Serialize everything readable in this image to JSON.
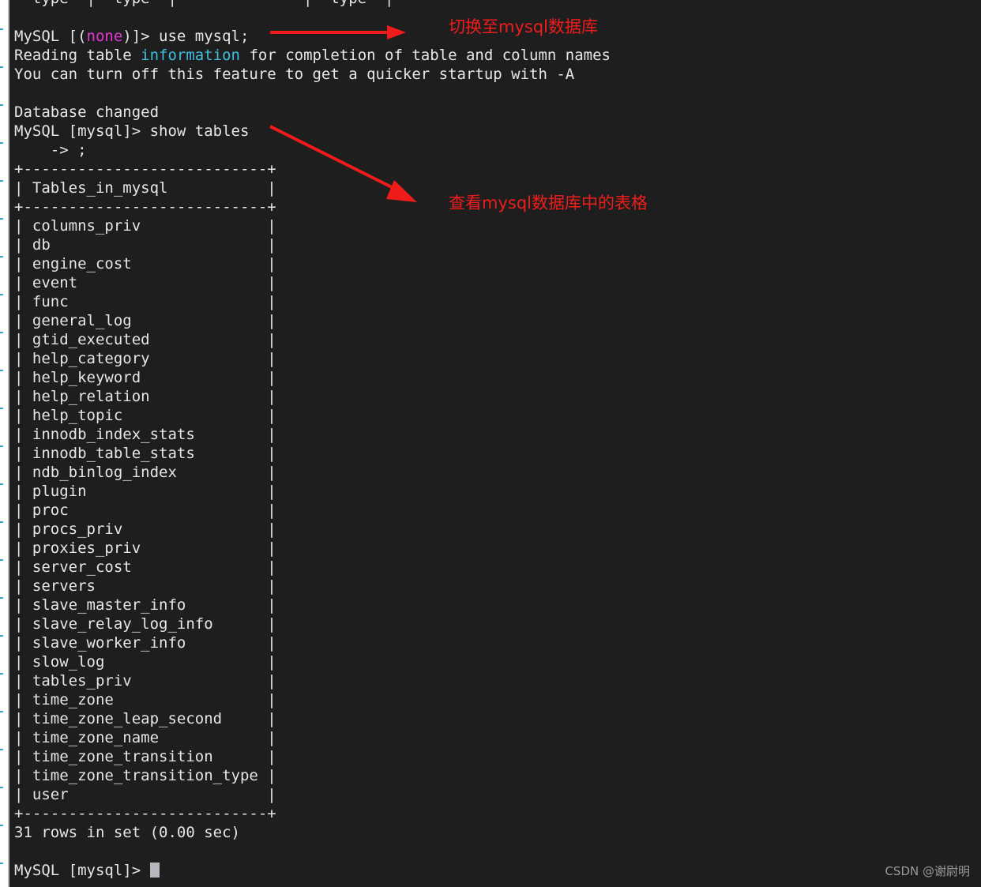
{
  "theme": {
    "terminal_bg": "#1e1e1e",
    "text_color": "#e6e6e6",
    "magenta": "#e23ad0",
    "cyan": "#3fbfe0",
    "annotation_red": "#f01c1c",
    "cursor_color": "#b6b6bd",
    "page_bg": "#ffffff"
  },
  "terminal": {
    "clipped_top_line": "  type  |  type  |              |  type  |",
    "prompt_1": {
      "prefix": "MySQL [(",
      "db": "none",
      "suffix": ")]> ",
      "command": "use mysql;"
    },
    "notice_1_pre": "Reading table ",
    "notice_1_kw": "information",
    "notice_1_post": " for completion of table and column names",
    "notice_2": "You can turn off this feature to get a quicker startup with -A",
    "blank_1": "",
    "db_changed": "Database changed",
    "prompt_2": {
      "prefix": "MySQL [mysql]> ",
      "command": "show tables"
    },
    "continuation": "    -> ;",
    "table": {
      "border": "+---------------------------+",
      "header": "| Tables_in_mysql           |",
      "rows": [
        "| columns_priv              |",
        "| db                        |",
        "| engine_cost               |",
        "| event                     |",
        "| func                      |",
        "| general_log               |",
        "| gtid_executed             |",
        "| help_category             |",
        "| help_keyword              |",
        "| help_relation             |",
        "| help_topic                |",
        "| innodb_index_stats        |",
        "| innodb_table_stats        |",
        "| ndb_binlog_index          |",
        "| plugin                    |",
        "| proc                      |",
        "| procs_priv                |",
        "| proxies_priv              |",
        "| server_cost               |",
        "| servers                   |",
        "| slave_master_info         |",
        "| slave_relay_log_info      |",
        "| slave_worker_info         |",
        "| slow_log                  |",
        "| tables_priv               |",
        "| time_zone                 |",
        "| time_zone_leap_second     |",
        "| time_zone_name            |",
        "| time_zone_transition      |",
        "| time_zone_transition_type |",
        "| user                      |"
      ],
      "table_names": [
        "columns_priv",
        "db",
        "engine_cost",
        "event",
        "func",
        "general_log",
        "gtid_executed",
        "help_category",
        "help_keyword",
        "help_relation",
        "help_topic",
        "innodb_index_stats",
        "innodb_table_stats",
        "ndb_binlog_index",
        "plugin",
        "proc",
        "procs_priv",
        "proxies_priv",
        "server_cost",
        "servers",
        "slave_master_info",
        "slave_relay_log_info",
        "slave_worker_info",
        "slow_log",
        "tables_priv",
        "time_zone",
        "time_zone_leap_second",
        "time_zone_name",
        "time_zone_transition",
        "time_zone_transition_type",
        "user"
      ],
      "column_header": "Tables_in_mysql"
    },
    "result_count": "31 rows in set (0.00 sec)",
    "final_prompt": "MySQL [mysql]> "
  },
  "annotations": [
    {
      "text": "切换至mysql数据库"
    },
    {
      "text": "查看mysql数据库中的表格"
    }
  ],
  "watermark": "CSDN @谢尉明"
}
